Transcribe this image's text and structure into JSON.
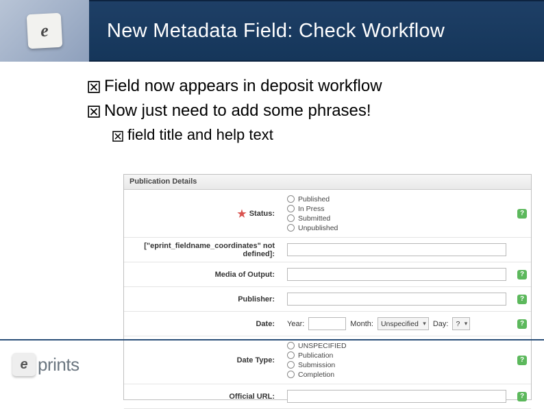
{
  "header": {
    "title": "New Metadata Field: Check Workflow",
    "logo_glyph": "e"
  },
  "bullets": {
    "b1": "Field now appears in deposit workflow",
    "b2": "Now just need to add some phrases!",
    "b2a": "field title and help text"
  },
  "form": {
    "section": "Publication Details",
    "status_label": "Status:",
    "status_options": {
      "o1": "Published",
      "o2": "In Press",
      "o3": "Submitted",
      "o4": "Unpublished"
    },
    "coords_label": "[\"eprint_fieldname_coordinates\" not defined]:",
    "media_label": "Media of Output:",
    "publisher_label": "Publisher:",
    "date_label": "Date:",
    "date_parts": {
      "year": "Year:",
      "month": "Month:",
      "month_val": "Unspecified",
      "day": "Day:",
      "day_val": "?"
    },
    "datetype_label": "Date Type:",
    "datetype_options": {
      "o1": "UNSPECIFIED",
      "o2": "Publication",
      "o3": "Submission",
      "o4": "Completion"
    },
    "url_label": "Official URL:"
  },
  "footer": {
    "logo_glyph": "e",
    "logo_text": "prints"
  }
}
